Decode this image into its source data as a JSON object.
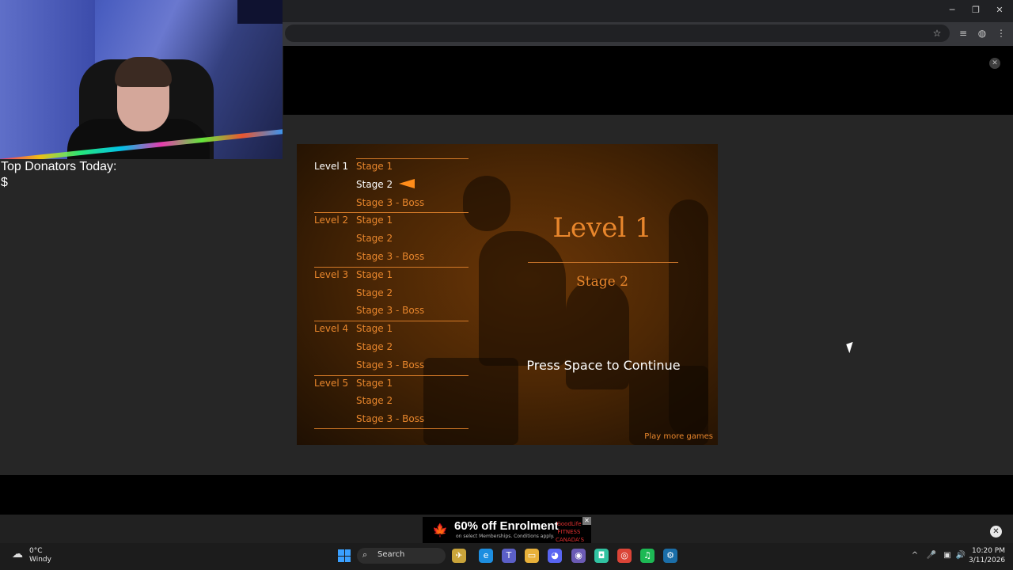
{
  "browser": {
    "minimize_glyph": "─",
    "restore_glyph": "❐",
    "close_glyph": "✕",
    "bookmark_glyph": "☆",
    "media_glyph": "≡",
    "extension_glyph": "◍",
    "menu_glyph": "⋮"
  },
  "banner": {
    "close_glyph": "✕"
  },
  "stream_overlay": {
    "donators_label": "Top Donators Today:",
    "donators_amount": "$"
  },
  "game": {
    "levels": [
      {
        "label": "Level 1",
        "stages": [
          "Stage 1",
          "Stage 2",
          "Stage 3 - Boss"
        ]
      },
      {
        "label": "Level 2",
        "stages": [
          "Stage 1",
          "Stage 2",
          "Stage 3 - Boss"
        ]
      },
      {
        "label": "Level 3",
        "stages": [
          "Stage 1",
          "Stage 2",
          "Stage 3 - Boss"
        ]
      },
      {
        "label": "Level 4",
        "stages": [
          "Stage 1",
          "Stage 2",
          "Stage 3 - Boss"
        ]
      },
      {
        "label": "Level 5",
        "stages": [
          "Stage 1",
          "Stage 2",
          "Stage 3 - Boss"
        ]
      }
    ],
    "selected_level_title": "Level 1",
    "selected_stage_title": "Stage 2",
    "continue_prompt": "Press Space to Continue",
    "play_more": "Play more games",
    "accent_color": "#e8862c"
  },
  "ad": {
    "headline": "60% off Enrolment",
    "fine_print": "on select Memberships. Conditions apply.",
    "brand": "GoodLife FITNESS CANADA'S GYM",
    "leaf_glyph": "🍁",
    "close_glyph": "✕"
  },
  "page_close_glyph": "✕",
  "taskbar": {
    "weather_icon": "☁",
    "weather_temp": "0°C",
    "weather_desc": "Windy",
    "search_icon": "⌕",
    "search_label": "Search",
    "apps": [
      {
        "name": "game-app-icon",
        "glyph": "✈",
        "color": "#c9a43a"
      },
      {
        "name": "edge-icon",
        "glyph": "e",
        "color": "#1d8ee0"
      },
      {
        "name": "teams-icon",
        "glyph": "T",
        "color": "#5b5fc7"
      },
      {
        "name": "file-explorer-icon",
        "glyph": "▭",
        "color": "#e8b13a"
      },
      {
        "name": "discord-icon",
        "glyph": "◕",
        "color": "#5865f2"
      },
      {
        "name": "obs-icon",
        "glyph": "◉",
        "color": "#6b5bb5"
      },
      {
        "name": "streamlabs-icon",
        "glyph": "◘",
        "color": "#31c3a2"
      },
      {
        "name": "chrome-icon",
        "glyph": "◎",
        "color": "#db4437"
      },
      {
        "name": "spotify-icon",
        "glyph": "♫",
        "color": "#1db954"
      },
      {
        "name": "steam-icon",
        "glyph": "⚙",
        "color": "#1b6ea8"
      }
    ],
    "tray": {
      "chevron_glyph": "^",
      "mic_glyph": "🎤",
      "display_glyph": "▣",
      "volume_glyph": "🔊"
    },
    "time": "10:20 PM",
    "date": "3/11/2026"
  }
}
